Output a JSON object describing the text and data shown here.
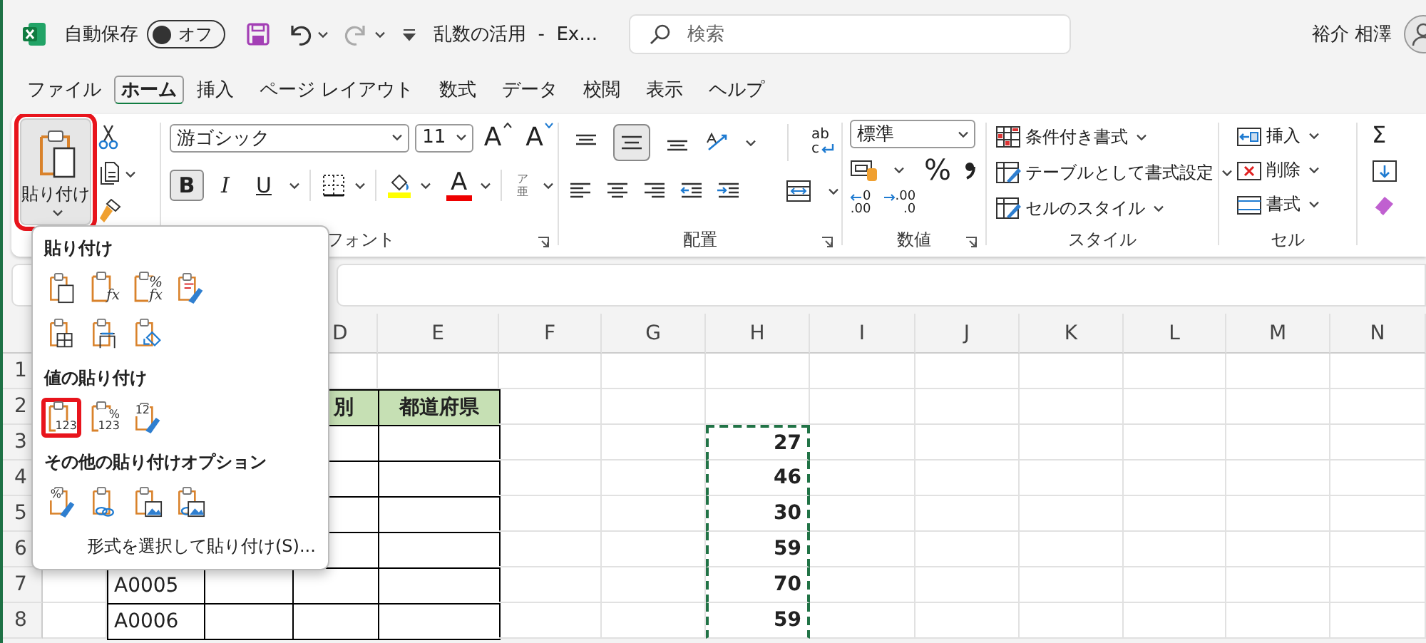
{
  "title_bar": {
    "autosave_label": "自動保存",
    "autosave": {
      "label": "オフ",
      "on": false
    },
    "document_title": "乱数の活用  -  Ex…",
    "search": {
      "placeholder": "検索"
    },
    "user_name": "裕介 相澤"
  },
  "ribbon_tabs": [
    {
      "label": "ファイル",
      "selected": false
    },
    {
      "label": "ホーム",
      "selected": true
    },
    {
      "label": "挿入",
      "selected": false
    },
    {
      "label": "ページ レイアウト",
      "selected": false
    },
    {
      "label": "数式",
      "selected": false
    },
    {
      "label": "データ",
      "selected": false
    },
    {
      "label": "校閲",
      "selected": false
    },
    {
      "label": "表示",
      "selected": false
    },
    {
      "label": "ヘルプ",
      "selected": false
    }
  ],
  "ribbon": {
    "paste_button": {
      "label": "貼り付け",
      "highlighted": true
    },
    "font": {
      "name": "游ゴシック",
      "size": "11",
      "grow_label": "A",
      "shrink_label": "A",
      "formats": [
        {
          "kind": "bold",
          "label": "B",
          "on": true
        },
        {
          "kind": "italic",
          "label": "I",
          "on": false
        },
        {
          "kind": "underline",
          "label": "U",
          "on": false
        }
      ],
      "font_color_label": "A",
      "phonetic_glyphs": [
        "ア",
        "亜"
      ],
      "group_label": "フォント"
    },
    "alignment": {
      "vertical": [
        {
          "kind": "top",
          "selected": false
        },
        {
          "kind": "middle",
          "selected": true
        },
        {
          "kind": "bottom",
          "selected": false
        }
      ],
      "wrap_glyphs": [
        "ab",
        "c"
      ],
      "group_label": "配置"
    },
    "number": {
      "format": "標準",
      "percent_label": "%",
      "decimal_buttons": [
        {
          "kind": "increase",
          "glyphs": [
            "0",
            ".00"
          ]
        },
        {
          "kind": "decrease",
          "glyphs": [
            ".00",
            ".0"
          ]
        }
      ],
      "group_label": "数値"
    },
    "styles": {
      "items": [
        {
          "kind": "conditional",
          "label": "条件付き書式"
        },
        {
          "kind": "table",
          "label": "テーブルとして書式設定"
        },
        {
          "kind": "cell_styles",
          "label": "セルのスタイル"
        }
      ],
      "group_label": "スタイル"
    },
    "cells": {
      "items": [
        {
          "kind": "insert",
          "label": "挿入"
        },
        {
          "kind": "delete",
          "label": "削除"
        },
        {
          "kind": "format",
          "label": "書式"
        }
      ],
      "group_label": "セル"
    },
    "editing": {
      "sum_label": "Σ"
    }
  },
  "paste_menu": {
    "sections": [
      {
        "title": "貼り付け",
        "options": [
          {
            "kind": "paste",
            "selected": false
          },
          {
            "kind": "formulas",
            "glyphs": [
              "fx"
            ],
            "selected": false
          },
          {
            "kind": "formulas_number",
            "glyphs": [
              "%",
              "fx"
            ],
            "selected": false
          },
          {
            "kind": "keep_source",
            "selected": false
          },
          {
            "kind": "no_borders",
            "selected": false
          },
          {
            "kind": "column_widths",
            "selected": false
          },
          {
            "kind": "transpose",
            "selected": false
          }
        ]
      },
      {
        "title": "値の貼り付け",
        "options": [
          {
            "kind": "values",
            "glyphs": [
              "123"
            ],
            "selected": true
          },
          {
            "kind": "values_number",
            "glyphs": [
              "%",
              "123"
            ],
            "selected": false
          },
          {
            "kind": "values_source",
            "glyphs": [
              "12"
            ],
            "selected": false
          }
        ]
      },
      {
        "title": "その他の貼り付けオプション",
        "options": [
          {
            "kind": "formatting",
            "glyphs": [
              "%"
            ],
            "selected": false
          },
          {
            "kind": "link",
            "selected": false
          },
          {
            "kind": "picture",
            "selected": false
          },
          {
            "kind": "linked_picture",
            "selected": false
          }
        ]
      }
    ],
    "footer": "形式を選択して貼り付け(S)..."
  },
  "sheet": {
    "columns": [
      "D",
      "E",
      "F",
      "G",
      "H",
      "I",
      "J",
      "K",
      "L",
      "M",
      "N"
    ],
    "rows": [
      {
        "header": "1"
      },
      {
        "header": "2",
        "header_fill": true,
        "column_d": "別",
        "column_e": "都道府県"
      },
      {
        "header": "3",
        "copied": true,
        "column_h": "27"
      },
      {
        "header": "4",
        "copied": true,
        "column_h": "46"
      },
      {
        "header": "5",
        "copied": true,
        "column_h": "30"
      },
      {
        "header": "6",
        "copied": true,
        "column_h": "59"
      },
      {
        "header": "7",
        "copied": true,
        "column_b": "A0005",
        "column_h": "70"
      },
      {
        "header": "8",
        "copied": true,
        "column_b": "A0006",
        "column_h": "59"
      }
    ]
  }
}
